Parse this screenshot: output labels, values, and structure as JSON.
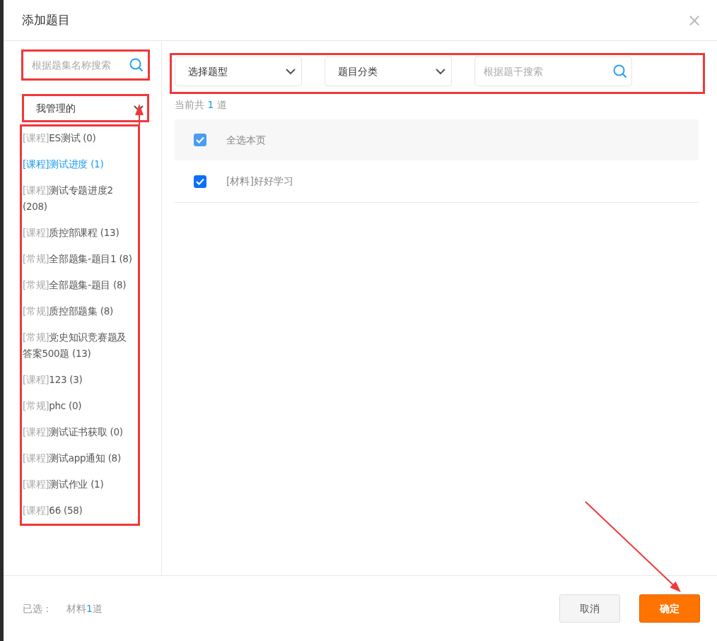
{
  "dialog": {
    "title": "添加题目",
    "close": "×"
  },
  "sidebar": {
    "search": {
      "placeholder": "根据题集名称搜索",
      "highlighted": true
    },
    "dropdown": {
      "value": "我管理的",
      "highlighted": true,
      "pointed": true
    },
    "list_highlighted": true,
    "items": [
      {
        "tag": "[课程]",
        "name": "ES测试 (0)",
        "selected": false
      },
      {
        "tag": "[课程]",
        "name": "测试进度 (1)",
        "selected": true
      },
      {
        "tag": "[课程]",
        "name": "测试专题进度2 (208)",
        "selected": false
      },
      {
        "tag": "[课程]",
        "name": "质控部课程 (13)",
        "selected": false
      },
      {
        "tag": "[常规]",
        "name": "全部题集-题目1 (8)",
        "selected": false
      },
      {
        "tag": "[常规]",
        "name": "全部题集-题目 (8)",
        "selected": false
      },
      {
        "tag": "[常规]",
        "name": "质控部题集 (8)",
        "selected": false
      },
      {
        "tag": "[常规]",
        "name": "党史知识竞赛题及答案500题 (13)",
        "selected": false
      },
      {
        "tag": "[课程]",
        "name": "123 (3)",
        "selected": false
      },
      {
        "tag": "[常规]",
        "name": "phc (0)",
        "selected": false
      },
      {
        "tag": "[课程]",
        "name": "测试证书获取 (0)",
        "selected": false
      },
      {
        "tag": "[课程]",
        "name": "测试app通知 (8)",
        "selected": false
      },
      {
        "tag": "[课程]",
        "name": "测试作业 (1)",
        "selected": false
      },
      {
        "tag": "[课程]",
        "name": "66 (58)",
        "selected": false
      }
    ]
  },
  "filters": {
    "highlighted": true,
    "type_select": "选择题型",
    "category_select": "题目分类",
    "search": {
      "placeholder": "根据题干搜索"
    }
  },
  "total": {
    "prefix": "当前共",
    "count": "1",
    "suffix": "道"
  },
  "select_all": {
    "label": "全选本页",
    "checked": true
  },
  "questions": [
    {
      "label": "[材料]好好学习",
      "checked": true
    }
  ],
  "footer": {
    "selected_label": "已选：",
    "summary_prefix": "材料",
    "summary_count": "1",
    "summary_suffix": "道",
    "cancel": "取消",
    "confirm": {
      "label": "确定",
      "pointed": true
    }
  }
}
